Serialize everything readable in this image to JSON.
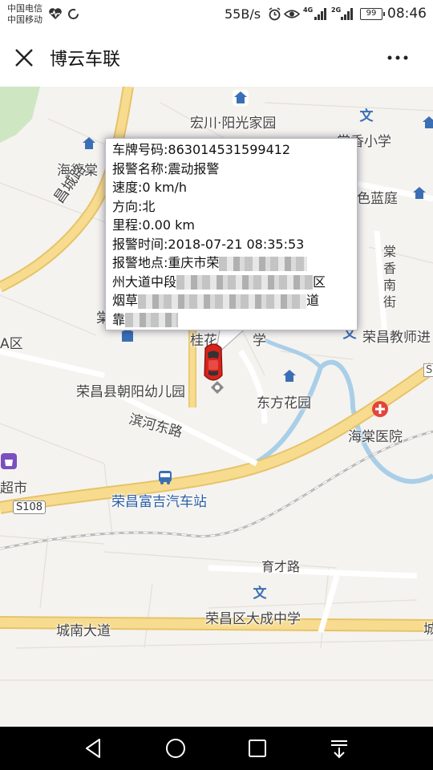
{
  "status_bar": {
    "carrier_1": "中国电信",
    "carrier_2": "中国移动",
    "net_speed": "55B/s",
    "signal_1": "4G",
    "signal_2": "2G",
    "battery": "99",
    "time": "08:46"
  },
  "header": {
    "title": "博云车联",
    "close_icon": "close-icon",
    "more_icon": "more-icon"
  },
  "alarm_popup": {
    "rows": [
      {
        "label": "车牌号码:",
        "value": "863014531599412"
      },
      {
        "label": "报警名称:",
        "value": "震动报警"
      },
      {
        "label": "速度:",
        "value": "0 km/h"
      },
      {
        "label": "方向:",
        "value": "北"
      },
      {
        "label": "里程:",
        "value": "0.00 km"
      },
      {
        "label": "报警时间:",
        "value": "2018-07-21 08:35:53"
      },
      {
        "label": "报警地点:",
        "value": "重庆市荣"
      }
    ],
    "address_line_2_start": "州大道中段",
    "address_line_2_end": "区",
    "address_line_3_start": "烟草",
    "address_line_3_end": "道",
    "address_line_4_start": "靠"
  },
  "map_labels": {
    "hongchuan": "宏川·阳光家园",
    "changxiang_school": "棠香小学",
    "haide": "海德棠",
    "lanting": "色蓝庭",
    "changcheng_road": "昌城路",
    "tangxiang_street": "棠香南街",
    "a_zone": "A区",
    "teacher": "荣昌教师进",
    "kindergarten": "荣昌县朝阳幼儿园",
    "dongfang": "东方花园",
    "binhe_road": "滨河东路",
    "haitang_hospital": "海棠医院",
    "supermarket": "超市",
    "s108": "S108",
    "bus_station": "荣昌富吉汽车站",
    "yucai_road": "育才路",
    "dacheng_school": "荣昌区大成中学",
    "chengnan_road": "城南大道",
    "huashi": "桂花",
    "xue": "学",
    "tang": "棠",
    "cheng_right": "城",
    "s_right": "S"
  },
  "colors": {
    "road_yellow": "#f7dc8f",
    "road_edge": "#e6c36a",
    "river": "#a9cfe8",
    "map_bg": "#f5f3ef",
    "poi_blue": "#3b6fb5",
    "hospital_red": "#e2453c",
    "car_red": "#d8221c"
  }
}
